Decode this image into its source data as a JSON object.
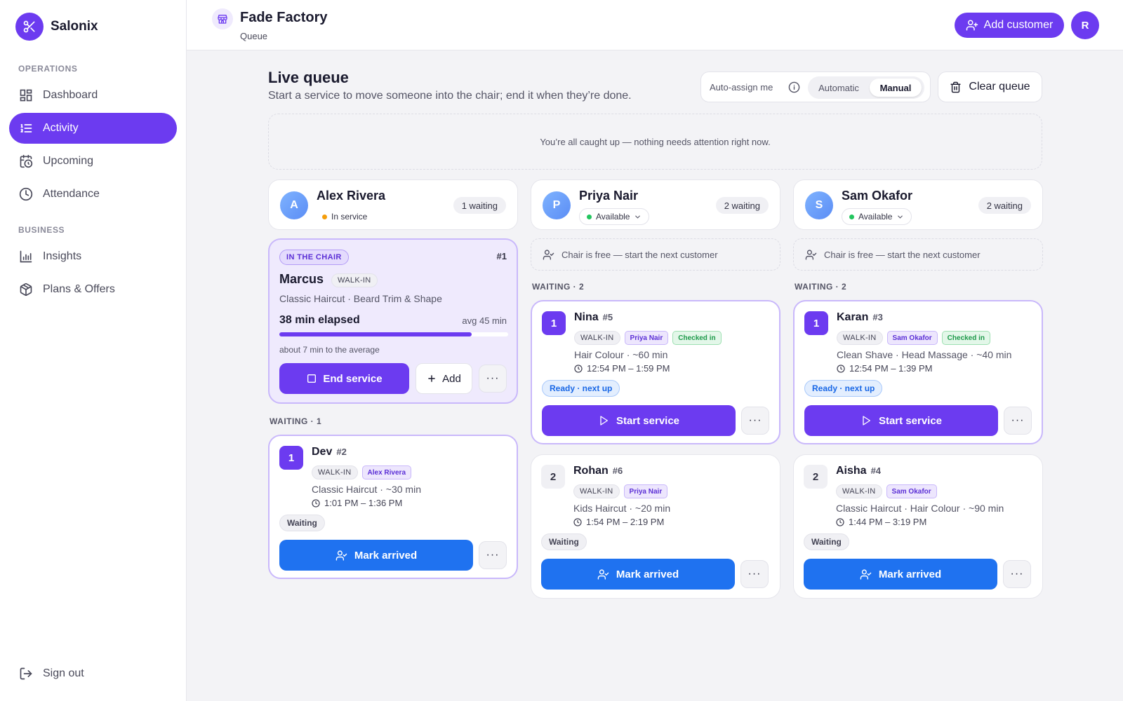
{
  "app": {
    "name": "Salonix"
  },
  "sidebar": {
    "sections": {
      "operations": "OPERATIONS",
      "business": "BUSINESS"
    },
    "items": [
      {
        "label": "Dashboard",
        "icon": "dashboard-icon"
      },
      {
        "label": "Activity",
        "icon": "list-icon",
        "active": true
      },
      {
        "label": "Upcoming",
        "icon": "calendar-clock-icon"
      },
      {
        "label": "Attendance",
        "icon": "clock-icon"
      },
      {
        "label": "Insights",
        "icon": "bar-chart-icon"
      },
      {
        "label": "Plans & Offers",
        "icon": "package-icon"
      }
    ],
    "signout": "Sign out"
  },
  "header": {
    "shop_name": "Fade Factory",
    "subtitle": "Queue",
    "add_customer": "Add customer",
    "avatar_initial": "R"
  },
  "main": {
    "title": "Live queue",
    "subtitle": "Start a service to move someone into the chair; end it when they’re done.",
    "auto_assign_label": "Auto-assign me",
    "mode_options": [
      "Automatic",
      "Manual"
    ],
    "mode_selected": "Manual",
    "clear_queue": "Clear queue",
    "caught_up": "You’re all caught up — nothing needs attention right now."
  },
  "columns": [
    {
      "barber": {
        "name": "Alex Rivera",
        "initial": "A",
        "status": "In service",
        "status_color": "#f59e0b",
        "waiting": "1 waiting"
      },
      "in_chair": {
        "badge": "IN THE CHAIR",
        "number": "#1",
        "customer": "Marcus",
        "type": "WALK-IN",
        "services": "Classic Haircut · Beard Trim & Shape",
        "elapsed": "38 min elapsed",
        "avg": "avg 45 min",
        "progress": 0.84,
        "remaining": "about 7 min to the average",
        "end_label": "End service",
        "add_label": "Add",
        "more": "···"
      },
      "waiting_label": "WAITING · 1",
      "queue": [
        {
          "pos": "1",
          "name": "Dev",
          "num": "#2",
          "type": "WALK-IN",
          "barber": "Alex Rivera",
          "services": "Classic Haircut · ~30 min",
          "time": "1:01 PM – 1:36 PM",
          "status": "Waiting",
          "action": "Mark arrived",
          "more": "···"
        }
      ]
    },
    {
      "barber": {
        "name": "Priya Nair",
        "initial": "P",
        "status": "Available",
        "status_color": "#22c55e",
        "waiting": "2 waiting"
      },
      "chair_free": "Chair is free — start the next customer",
      "waiting_label": "WAITING · 2",
      "queue": [
        {
          "pos": "1",
          "name": "Nina",
          "num": "#5",
          "type": "WALK-IN",
          "barber": "Priya Nair",
          "checked": "Checked in",
          "services": "Hair Colour · ~60 min",
          "time": "12:54 PM – 1:59 PM",
          "status": "Ready · next up",
          "action": "Start service",
          "more": "···"
        },
        {
          "pos": "2",
          "name": "Rohan",
          "num": "#6",
          "type": "WALK-IN",
          "barber": "Priya Nair",
          "services": "Kids Haircut · ~20 min",
          "time": "1:54 PM – 2:19 PM",
          "status": "Waiting",
          "action": "Mark arrived",
          "more": "···"
        }
      ]
    },
    {
      "barber": {
        "name": "Sam Okafor",
        "initial": "S",
        "status": "Available",
        "status_color": "#22c55e",
        "waiting": "2 waiting"
      },
      "chair_free": "Chair is free — start the next customer",
      "waiting_label": "WAITING · 2",
      "queue": [
        {
          "pos": "1",
          "name": "Karan",
          "num": "#3",
          "type": "WALK-IN",
          "barber": "Sam Okafor",
          "checked": "Checked in",
          "services": "Clean Shave · Head Massage · ~40 min",
          "time": "12:54 PM – 1:39 PM",
          "status": "Ready · next up",
          "action": "Start service",
          "more": "···"
        },
        {
          "pos": "2",
          "name": "Aisha",
          "num": "#4",
          "type": "WALK-IN",
          "barber": "Sam Okafor",
          "services": "Classic Haircut · Hair Colour · ~90 min",
          "time": "1:44 PM – 3:19 PM",
          "status": "Waiting",
          "action": "Mark arrived",
          "more": "···"
        }
      ]
    }
  ]
}
